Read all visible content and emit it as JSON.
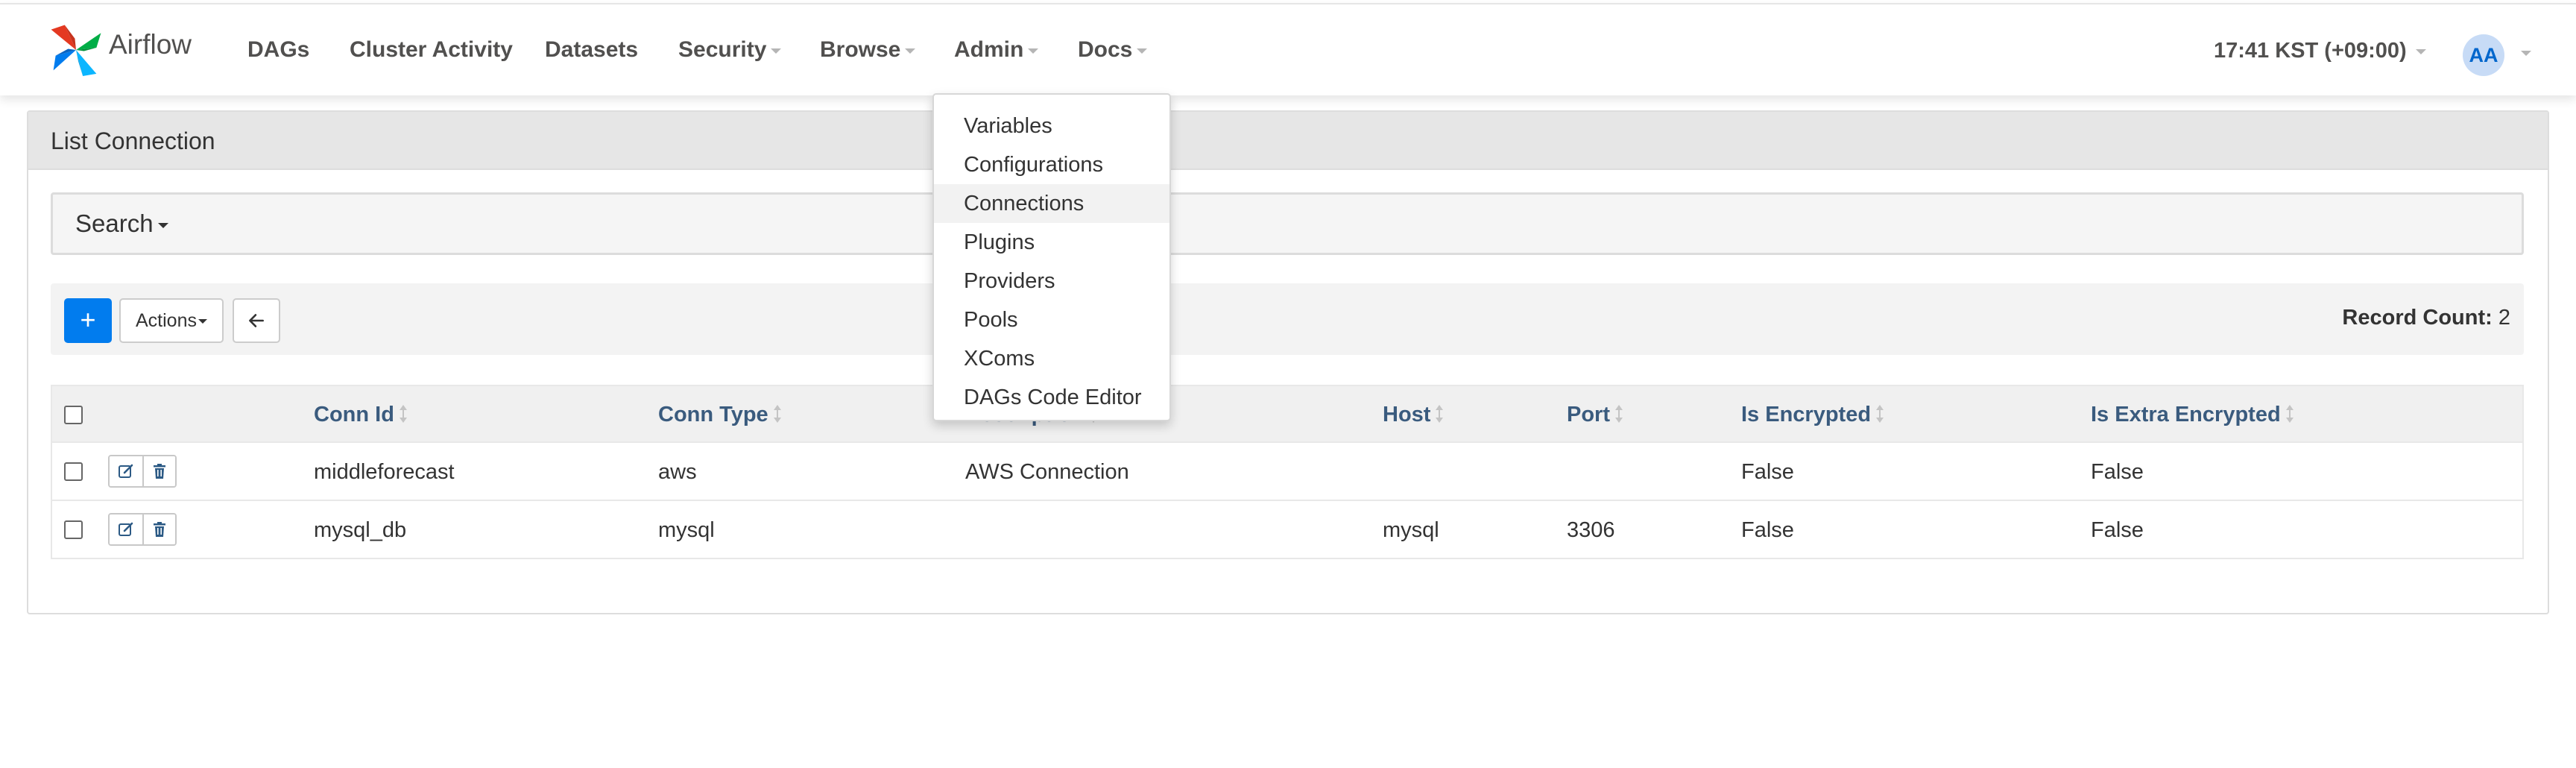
{
  "brand": {
    "name": "Airflow",
    "icon": "airflow-pinwheel-icon"
  },
  "nav": {
    "dags": "DAGs",
    "cluster_activity": "Cluster Activity",
    "datasets": "Datasets",
    "security": "Security",
    "browse": "Browse",
    "admin": "Admin",
    "docs": "Docs",
    "clock": "17:41 KST (+09:00)",
    "avatar_initials": "AA"
  },
  "admin_menu": {
    "items": [
      "Variables",
      "Configurations",
      "Connections",
      "Plugins",
      "Providers",
      "Pools",
      "XComs",
      "DAGs Code Editor"
    ],
    "active": "Connections"
  },
  "page": {
    "title": "List Connection",
    "search_label": "Search",
    "add_label": "+",
    "actions_label": "Actions",
    "record_count_label": "Record Count:",
    "record_count_value": "2"
  },
  "table": {
    "columns": [
      "Conn Id",
      "Conn Type",
      "Description",
      "Host",
      "Port",
      "Is Encrypted",
      "Is Extra Encrypted"
    ],
    "rows": [
      {
        "conn_id": "middleforecast",
        "conn_type": "aws",
        "description": "AWS Connection",
        "host": "",
        "port": "",
        "is_encrypted": "False",
        "is_extra_encrypted": "False"
      },
      {
        "conn_id": "mysql_db",
        "conn_type": "mysql",
        "description": "",
        "host": "mysql",
        "port": "3306",
        "is_encrypted": "False",
        "is_extra_encrypted": "False"
      }
    ]
  },
  "colors": {
    "primary": "#017cee",
    "header_link": "#3a5b7e",
    "avatar_bg": "#c7dbf6",
    "panel_heading_bg": "#e6e6e6"
  }
}
